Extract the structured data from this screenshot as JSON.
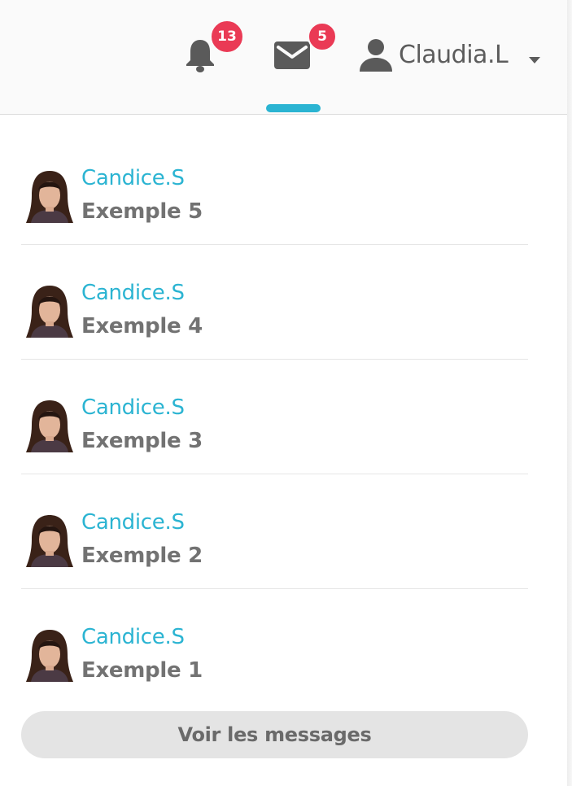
{
  "header": {
    "notifications": {
      "icon": "bell-icon",
      "badge": "13"
    },
    "messages": {
      "icon": "mail-icon",
      "badge": "5",
      "active": true
    },
    "user": {
      "icon": "user-icon",
      "name": "Claudia.L",
      "dropdown_icon": "caret-down-icon"
    }
  },
  "messages": [
    {
      "sender": "Candice.S",
      "preview": "Exemple 5",
      "avatar": "avatar-photo"
    },
    {
      "sender": "Candice.S",
      "preview": "Exemple 4",
      "avatar": "avatar-photo"
    },
    {
      "sender": "Candice.S",
      "preview": "Exemple 3",
      "avatar": "avatar-photo"
    },
    {
      "sender": "Candice.S",
      "preview": "Exemple 2",
      "avatar": "avatar-photo"
    },
    {
      "sender": "Candice.S",
      "preview": "Exemple 1",
      "avatar": "avatar-photo"
    }
  ],
  "footer": {
    "see_all_label": "Voir les messages"
  },
  "colors": {
    "accent": "#2bb4d2",
    "badge": "#ea3a55",
    "text_muted": "#727272",
    "button_bg": "#e4e4e4"
  }
}
